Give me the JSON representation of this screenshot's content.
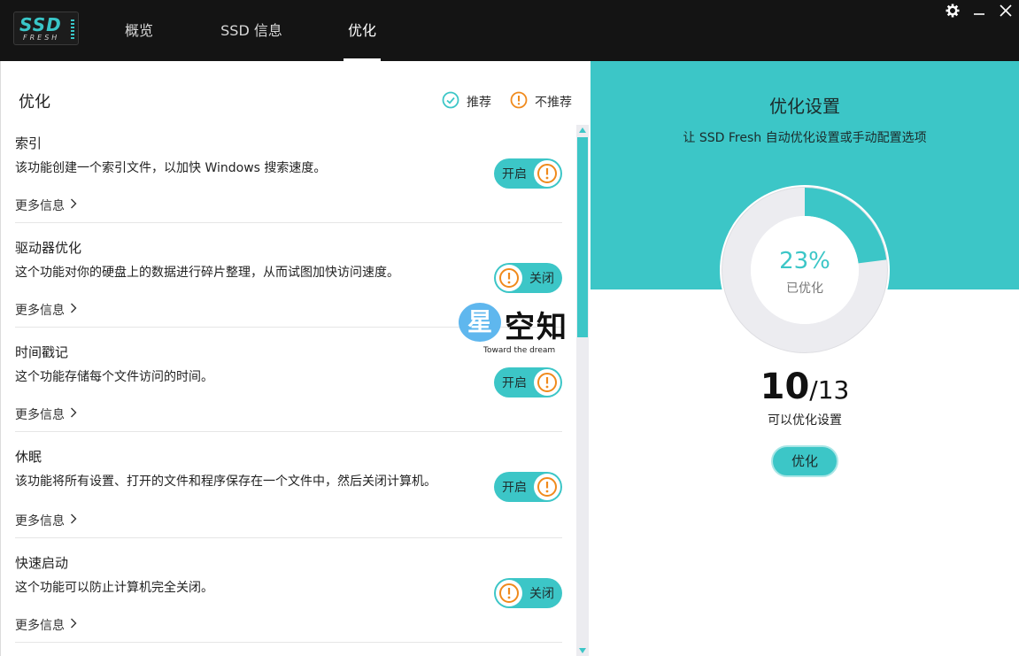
{
  "app": {
    "logo_main": "SSD",
    "logo_sub": "FRESH"
  },
  "tabs": [
    {
      "label": "概览"
    },
    {
      "label": "SSD 信息"
    },
    {
      "label": "优化"
    }
  ],
  "left": {
    "title": "优化",
    "legend": {
      "recommended": "推荐",
      "not_recommended": "不推荐"
    },
    "features": [
      {
        "name": "索引",
        "desc": "该功能创建一个索引文件，以加快 Windows 搜索速度。",
        "more": "更多信息",
        "toggle": "开启",
        "state": "on"
      },
      {
        "name": "驱动器优化",
        "desc": "这个功能对你的硬盘上的数据进行碎片整理，从而试图加快访问速度。",
        "more": "更多信息",
        "toggle": "关闭",
        "state": "off"
      },
      {
        "name": "时间戳记",
        "desc": "这个功能存储每个文件访问的时间。",
        "more": "更多信息",
        "toggle": "开启",
        "state": "on"
      },
      {
        "name": "休眠",
        "desc": "该功能将所有设置、打开的文件和程序保存在一个文件中，然后关闭计算机。",
        "more": "更多信息",
        "toggle": "开启",
        "state": "on"
      },
      {
        "name": "快速启动",
        "desc": "这个功能可以防止计算机完全关闭。",
        "more": "更多信息",
        "toggle": "关闭",
        "state": "off"
      }
    ]
  },
  "watermark": {
    "main": "空知",
    "star": "星",
    "sub": "Toward the dream"
  },
  "right": {
    "title": "优化设置",
    "subtitle": "让 SSD Fresh 自动优化设置或手动配置选项",
    "percent_text": "23%",
    "percent_value": 0.23,
    "percent_label": "已优化",
    "count_done": "10",
    "count_total": "/13",
    "count_label": "可以优化设置",
    "button": "优化"
  },
  "colors": {
    "accent": "#3cc6c7",
    "warning": "#f08a1c",
    "titlebar": "#141414"
  }
}
